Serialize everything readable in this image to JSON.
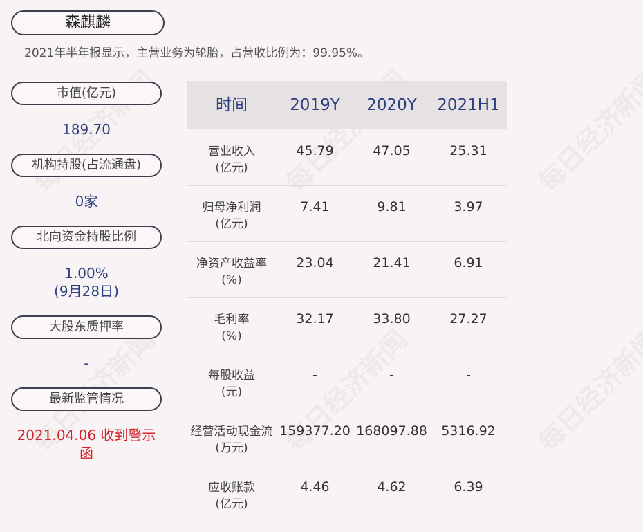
{
  "company": "森麒麟",
  "summary": "2021年半年报显示，主营业务为轮胎，占营收比例为：99.95%。",
  "left": {
    "market_cap_label": "市值(亿元)",
    "market_cap_value": "189.70",
    "institution_label": "机构持股(占流通盘)",
    "institution_value": "0家",
    "northbound_label": "北向资金持股比例",
    "northbound_value": "1.00%",
    "northbound_date": "(9月28日)",
    "pledge_label": "大股东质押率",
    "pledge_value": "-",
    "regulation_label": "最新监管情况",
    "regulation_value": "2021.04.06 收到警示函"
  },
  "table": {
    "headers": [
      "时间",
      "2019Y",
      "2020Y",
      "2021H1"
    ],
    "rows": [
      {
        "label": "营业收入",
        "unit": "(亿元)",
        "values": [
          "45.79",
          "47.05",
          "25.31"
        ]
      },
      {
        "label": "归母净利润",
        "unit": "(亿元)",
        "values": [
          "7.41",
          "9.81",
          "3.97"
        ]
      },
      {
        "label": "净资产收益率",
        "unit": "(%)",
        "values": [
          "23.04",
          "21.41",
          "6.91"
        ]
      },
      {
        "label": "毛利率",
        "unit": "(%)",
        "values": [
          "32.17",
          "33.80",
          "27.27"
        ]
      },
      {
        "label": "每股收益",
        "unit": "(元)",
        "values": [
          "-",
          "-",
          "-"
        ]
      },
      {
        "label": "经营活动现金流",
        "unit": "(万元)",
        "values": [
          "159377.20",
          "168097.88",
          "5316.92"
        ]
      },
      {
        "label": "应收账款",
        "unit": "(亿元)",
        "values": [
          "4.46",
          "4.62",
          "6.39"
        ]
      }
    ]
  },
  "watermark": "每日经济新闻"
}
